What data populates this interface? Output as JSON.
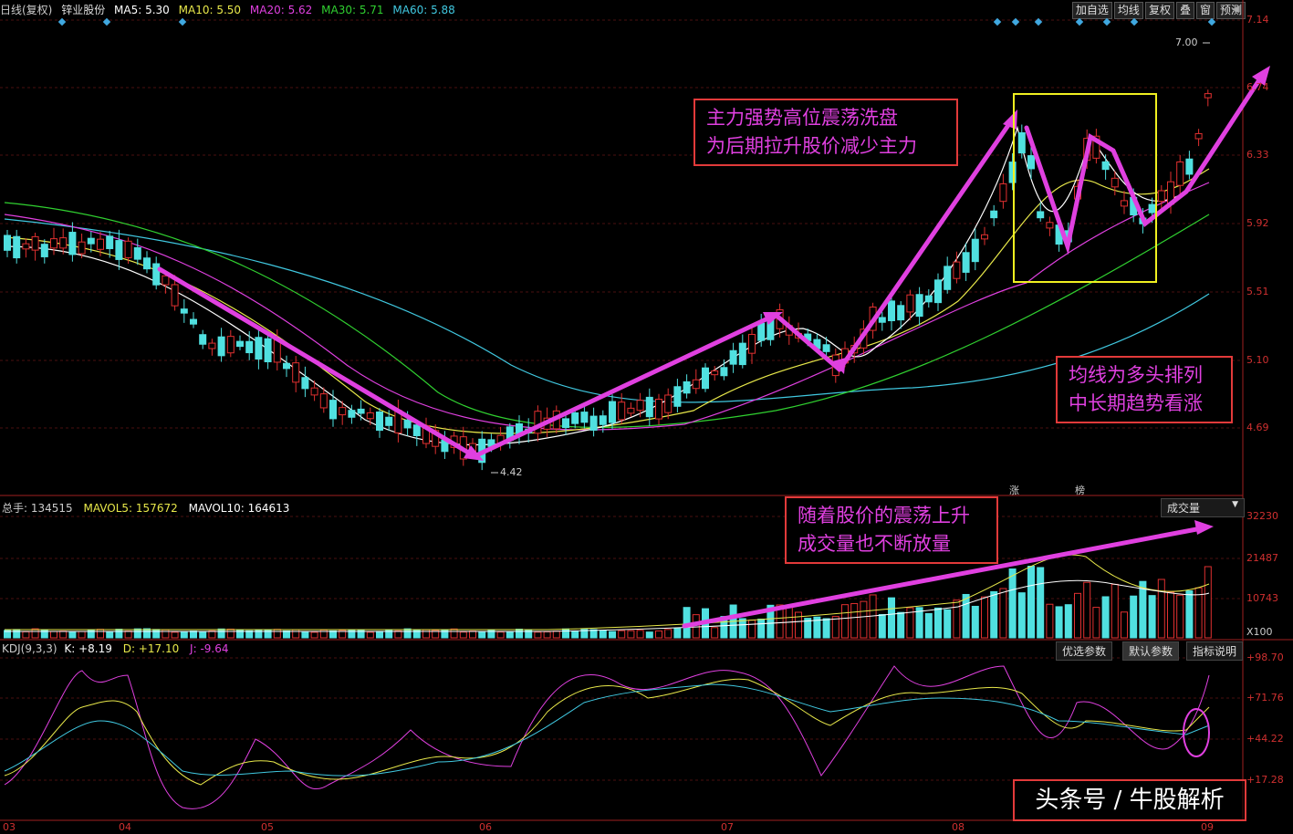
{
  "header": {
    "period": "日线(复权)",
    "stock": "锌业股份",
    "ma5": "MA5: 5.30",
    "ma10": "MA10: 5.50",
    "ma20": "MA20: 5.62",
    "ma30": "MA30: 5.71",
    "ma60": "MA60: 5.88",
    "colors": {
      "ma5": "#ffffff",
      "ma10": "#e8e84a",
      "ma20": "#e040e0",
      "ma30": "#30d030",
      "ma60": "#40c8e0"
    }
  },
  "toolbar": [
    "加自选",
    "均线",
    "复权",
    "叠",
    "窗",
    "预测"
  ],
  "price_axis": [
    "7.14",
    "6.74",
    "6.33",
    "5.92",
    "5.51",
    "5.10",
    "4.69"
  ],
  "price_high_label": "7.00",
  "price_low_label": "4.42",
  "badges": [
    "涨",
    "榜"
  ],
  "annotations": {
    "box1_line1": "主力强势高位震荡洗盘",
    "box1_line2": "为后期拉升股价减少主力",
    "box2_line1": "均线为多头排列",
    "box2_line2": "中长期趋势看涨",
    "box3_line1": "随着股价的震荡上升",
    "box3_line2": "成交量也不断放量"
  },
  "volume": {
    "total": "总手: 134515",
    "mavol5": "MAVOL5: 157672",
    "mavol10": "MAVOL10: 164613",
    "selector": "成交量",
    "axis": [
      "32230",
      "21487",
      "10743",
      "X100"
    ]
  },
  "kdj": {
    "name": "KDJ(9,3,3)",
    "k": "K: +8.19",
    "d": "D: +17.10",
    "j": "J: -9.64",
    "buttons": [
      "优选参数",
      "默认参数",
      "指标说明"
    ],
    "axis": [
      "+98.70",
      "+71.76",
      "+44.22",
      "+17.28"
    ]
  },
  "date_axis": [
    "03",
    "04",
    "05",
    "06",
    "07",
    "08",
    "09"
  ],
  "watermark": "头条号 / 牛股解析"
}
